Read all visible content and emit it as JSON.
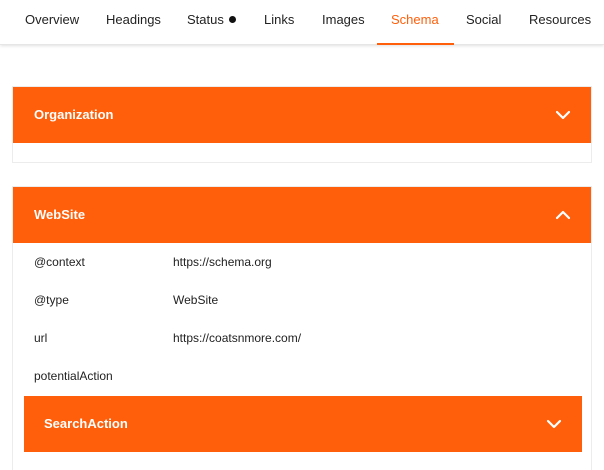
{
  "tabs": [
    {
      "label": "Overview"
    },
    {
      "label": "Headings"
    },
    {
      "label": "Status"
    },
    {
      "label": "Links"
    },
    {
      "label": "Images"
    },
    {
      "label": "Schema",
      "active": true
    },
    {
      "label": "Social"
    },
    {
      "label": "Resources"
    }
  ],
  "colors": {
    "accent": "#ff5f0a"
  },
  "schema": {
    "organization": {
      "title": "Organization",
      "expanded": false
    },
    "website": {
      "title": "WebSite",
      "expanded": true,
      "properties": [
        {
          "key": "@context",
          "value": "https://schema.org"
        },
        {
          "key": "@type",
          "value": "WebSite"
        },
        {
          "key": "url",
          "value": "https://coatsnmore.com/"
        },
        {
          "key": "potentialAction",
          "value": ""
        }
      ],
      "nested": {
        "title": "SearchAction",
        "expanded": false
      }
    }
  }
}
